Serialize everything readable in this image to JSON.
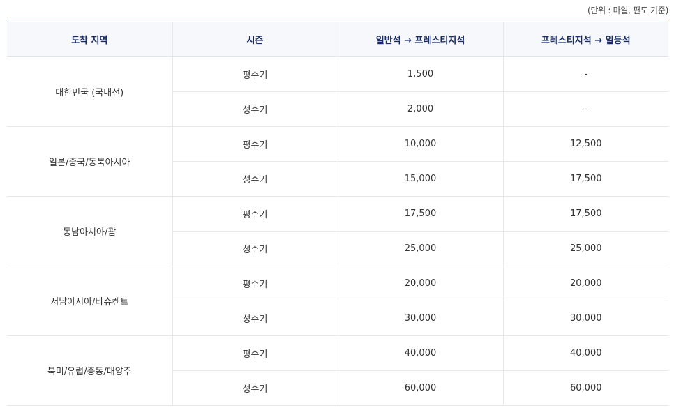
{
  "unit_note": "(단위 : 마일, 편도 기준)",
  "headers": [
    "도착 지역",
    "시즌",
    "일반석 → 프레스티지석",
    "프레스티지석 → 일등석"
  ],
  "groups": [
    {
      "region": "대한민국 (국내선)",
      "rows": [
        {
          "season": "평수기",
          "economy_to_prestige": "1,500",
          "prestige_to_first": "-"
        },
        {
          "season": "성수기",
          "economy_to_prestige": "2,000",
          "prestige_to_first": "-"
        }
      ]
    },
    {
      "region": "일본/중국/동북아시아",
      "rows": [
        {
          "season": "평수기",
          "economy_to_prestige": "10,000",
          "prestige_to_first": "12,500"
        },
        {
          "season": "성수기",
          "economy_to_prestige": "15,000",
          "prestige_to_first": "17,500"
        }
      ]
    },
    {
      "region": "동남아시아/괌",
      "rows": [
        {
          "season": "평수기",
          "economy_to_prestige": "17,500",
          "prestige_to_first": "17,500"
        },
        {
          "season": "성수기",
          "economy_to_prestige": "25,000",
          "prestige_to_first": "25,000"
        }
      ]
    },
    {
      "region": "서남아시아/타슈켄트",
      "rows": [
        {
          "season": "평수기",
          "economy_to_prestige": "20,000",
          "prestige_to_first": "20,000"
        },
        {
          "season": "성수기",
          "economy_to_prestige": "30,000",
          "prestige_to_first": "30,000"
        }
      ]
    },
    {
      "region": "북미/유럽/중동/대양주",
      "rows": [
        {
          "season": "평수기",
          "economy_to_prestige": "40,000",
          "prestige_to_first": "40,000"
        },
        {
          "season": "성수기",
          "economy_to_prestige": "60,000",
          "prestige_to_first": "60,000"
        }
      ]
    }
  ],
  "colors": {
    "header_text": "#1a2c66",
    "header_top_border": "#1f3a86",
    "header_bg": "#f6f8fb",
    "grid_line": "#e6e8ec"
  }
}
